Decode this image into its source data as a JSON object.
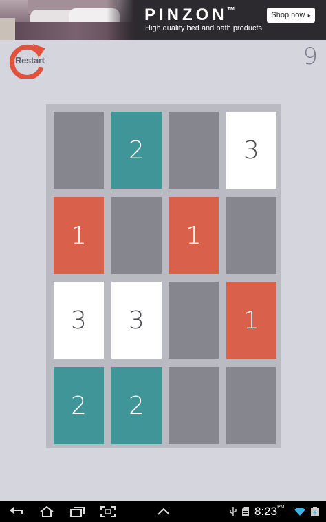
{
  "ad": {
    "brand": "PINZON",
    "trademark": "TM",
    "tagline": "High quality bed and bath products",
    "cta": "Shop now"
  },
  "header": {
    "restart_label": "Restart",
    "score": "9"
  },
  "board": {
    "rows": 4,
    "cols": 4,
    "tiles": [
      [
        "",
        "2",
        "",
        "3"
      ],
      [
        "1",
        "",
        "1",
        ""
      ],
      [
        "3",
        "3",
        "",
        "1"
      ],
      [
        "2",
        "2",
        "",
        ""
      ]
    ]
  },
  "colors": {
    "background": "#d5d5dd",
    "board": "#babac3",
    "empty_tile": "#86868e",
    "one_tile": "#d9604a",
    "two_tile": "#3f9598",
    "three_tile": "#ffffff",
    "restart_accent": "#e0523c"
  },
  "status_bar": {
    "time": "8:23",
    "time_suffix": "PM",
    "icons": [
      "usb-icon",
      "sd-card-icon",
      "wifi-icon",
      "battery-icon"
    ]
  },
  "nav_bar": {
    "buttons": [
      "back-icon",
      "home-icon",
      "recent-apps-icon",
      "screenshot-icon",
      "menu-up-icon"
    ]
  }
}
